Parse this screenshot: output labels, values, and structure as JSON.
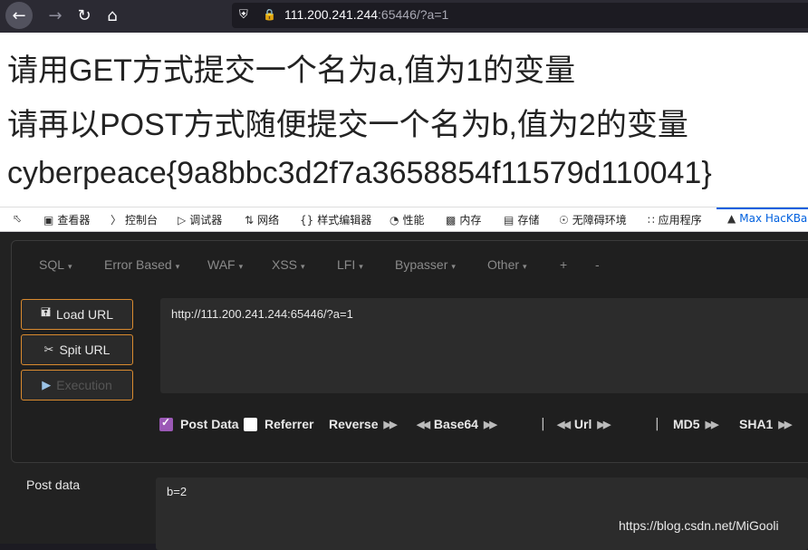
{
  "browser": {
    "url_host": "111.200.241.244",
    "url_rest": ":65446/?a=1"
  },
  "page": {
    "line1": "请用GET方式提交一个名为a,值为1的变量",
    "line2": "请再以POST方式随便提交一个名为b,值为2的变量",
    "line3": "cyberpeace{9a8bbc3d2f7a3658854f11579d110041}"
  },
  "devtools": {
    "tabs": [
      "查看器",
      "控制台",
      "调试器",
      "网络",
      "样式编辑器",
      "性能",
      "内存",
      "存储",
      "无障碍环境",
      "应用程序",
      "Max HacKBar"
    ]
  },
  "hackbar": {
    "menu": [
      "SQL",
      "Error Based",
      "WAF",
      "XSS",
      "LFI",
      "Bypasser",
      "Other",
      "+",
      "-"
    ],
    "load_url": "Load URL",
    "split_url": "Spit URL",
    "execution": "Execution",
    "url_value": "http://111.200.241.244:65446/?a=1",
    "options": {
      "post_data": "Post Data",
      "referrer": "Referrer",
      "reverse": "Reverse",
      "base64": "Base64",
      "url": "Url",
      "md5": "MD5",
      "sha1": "SHA1",
      "separator": "|"
    },
    "post_label": "Post data",
    "post_value": "b=2"
  },
  "watermark": "https://blog.csdn.net/MiGooli"
}
